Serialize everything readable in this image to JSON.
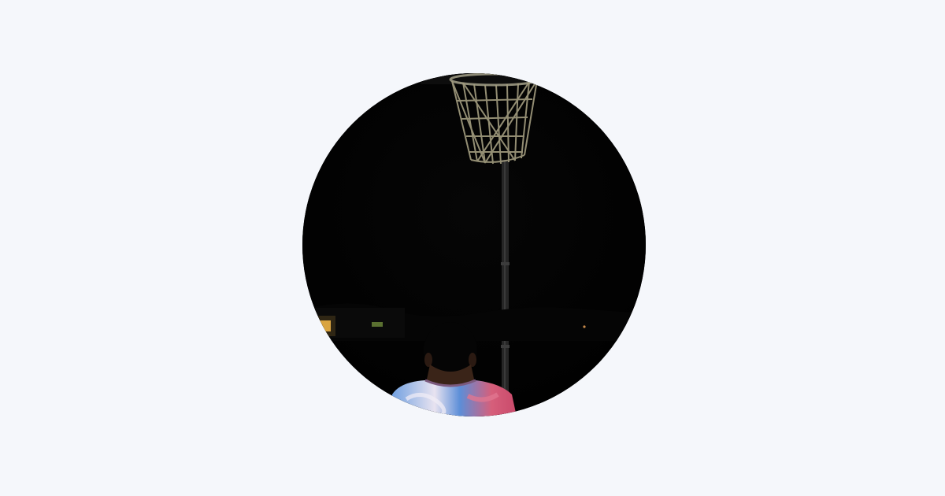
{
  "page": {
    "background_color": "#f5f7fb"
  },
  "profile_image": {
    "scene": "night-basketball-hoop",
    "colors": {
      "sky": "#020202",
      "net": "#9a9478",
      "pole": "#2a2a2a",
      "skin": "#3a2418",
      "shirt_blue": "#5a8fd6",
      "shirt_pink": "#d9607a",
      "shirt_white": "#e9e4ee",
      "light_warm": "#d9a441"
    }
  }
}
